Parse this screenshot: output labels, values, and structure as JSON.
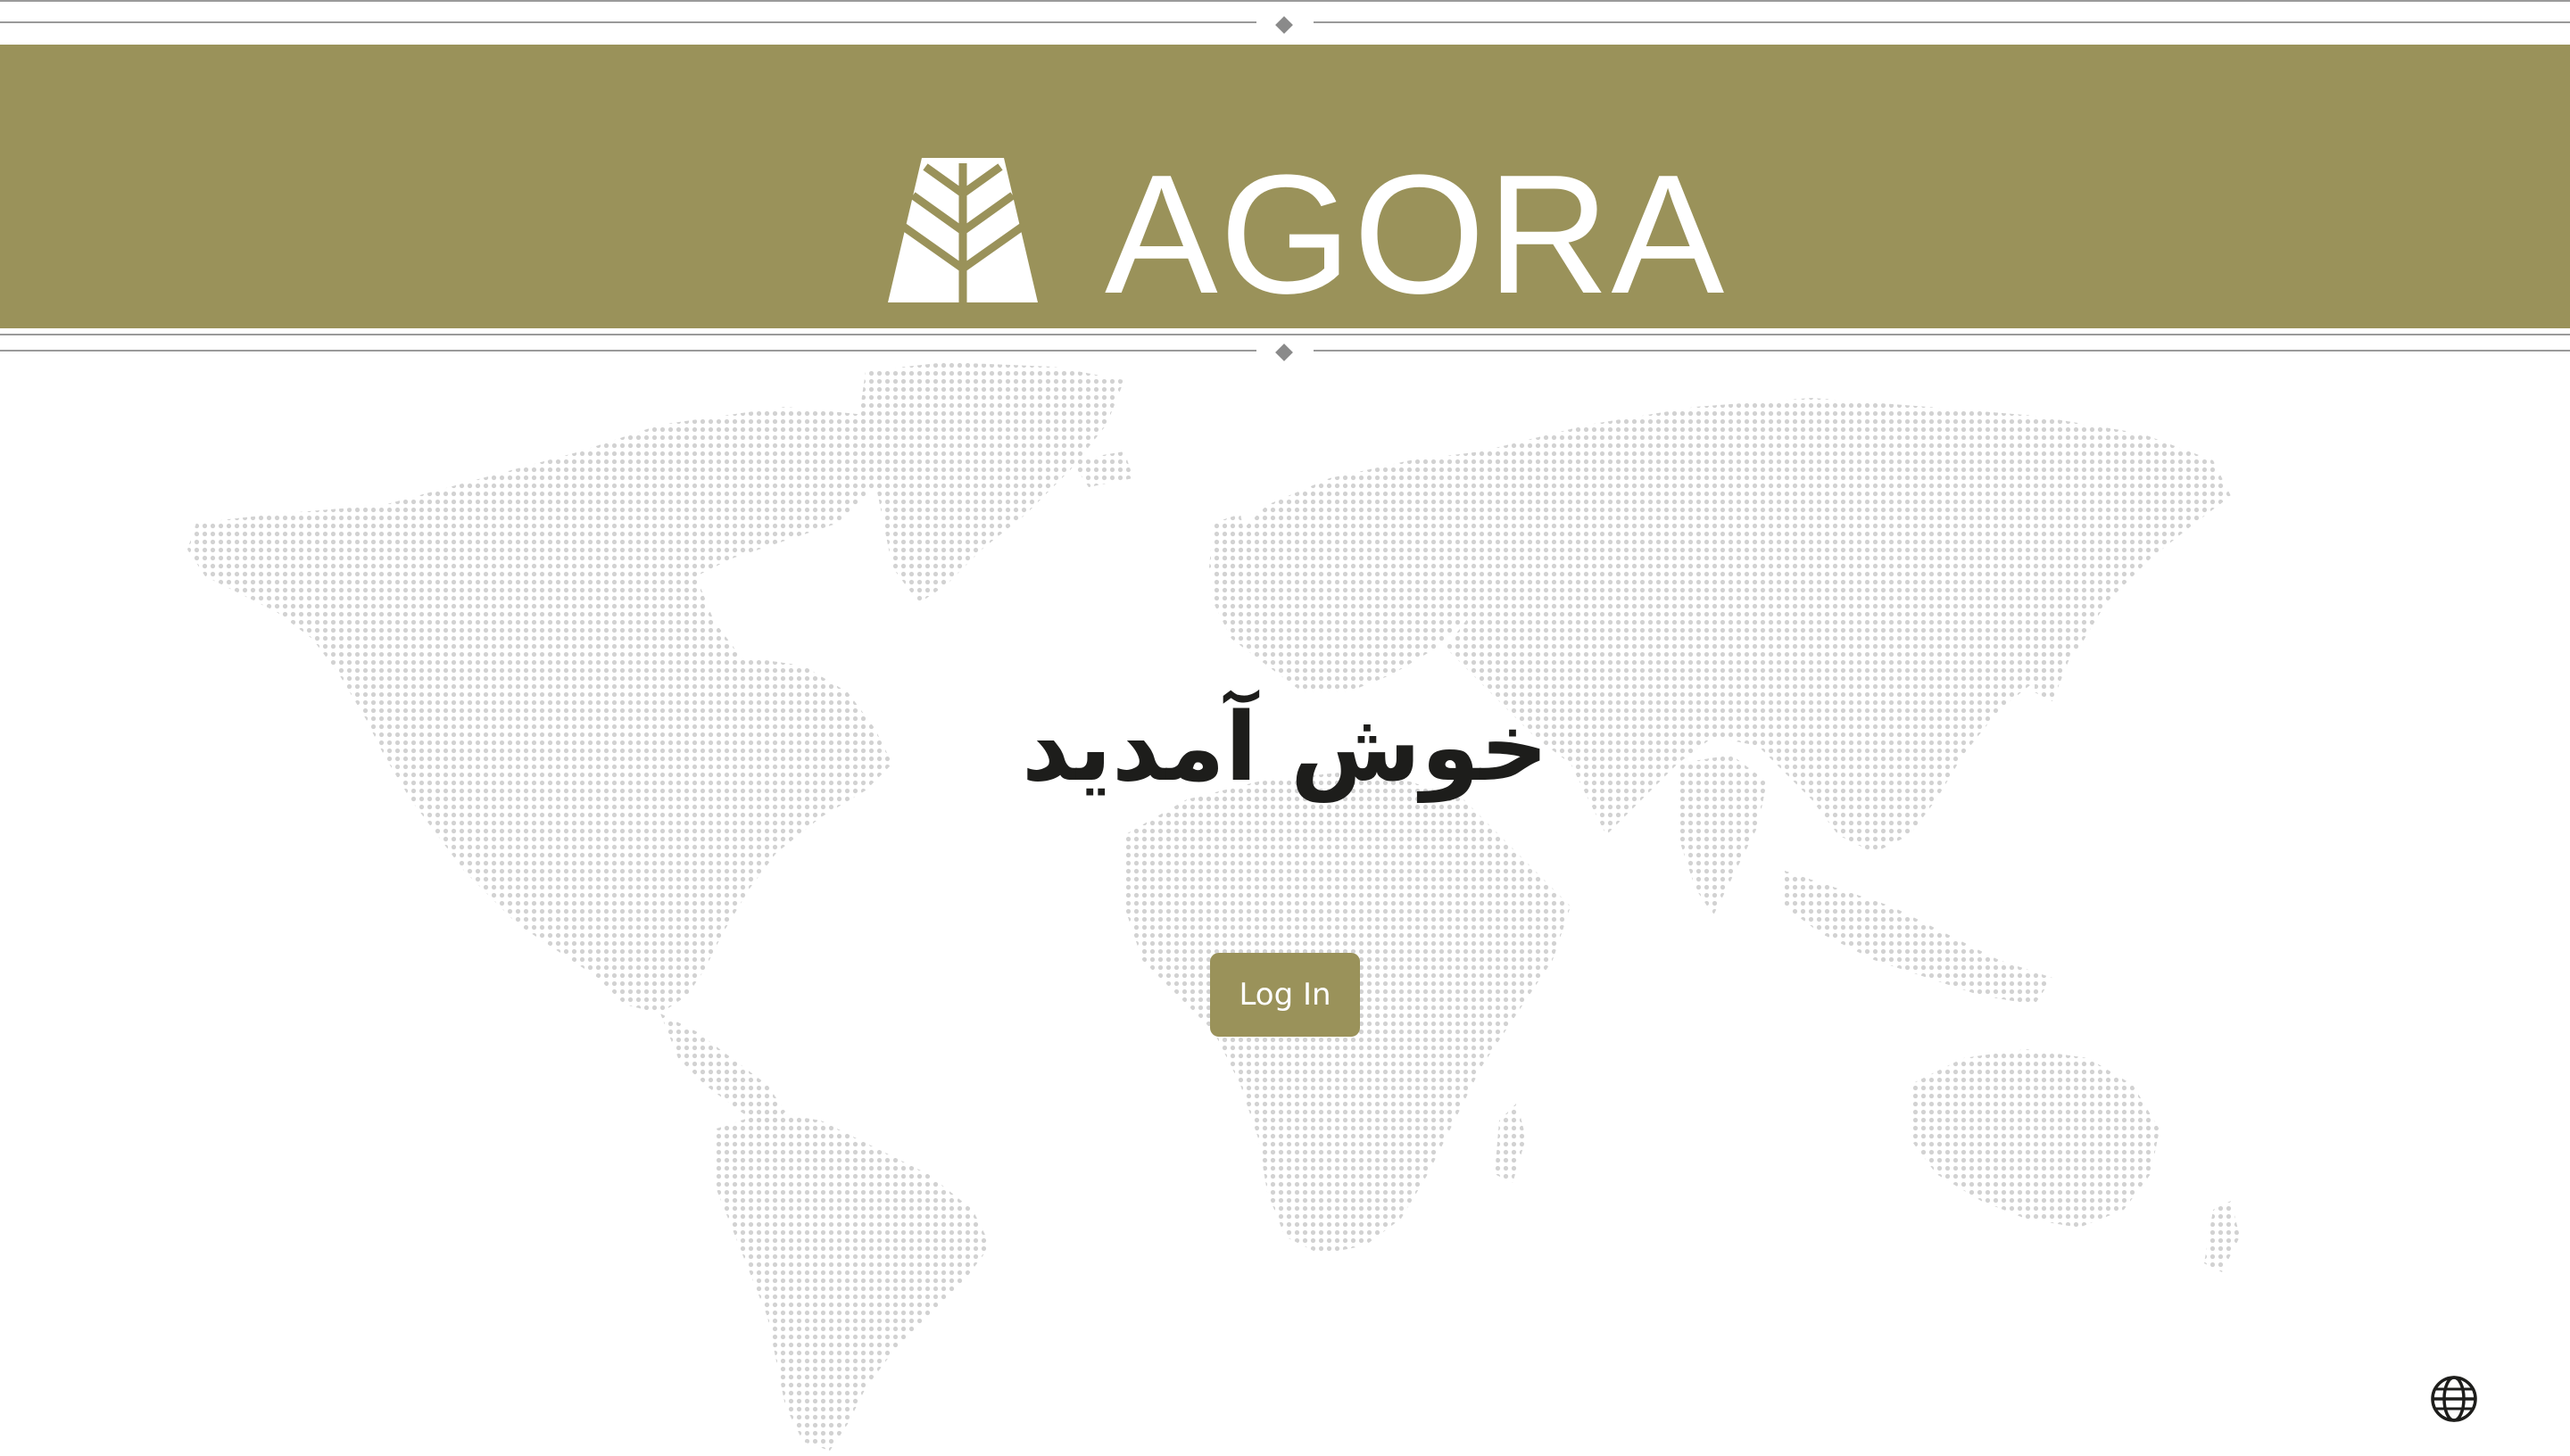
{
  "brand": {
    "name": "AGORA",
    "color": "#9a925a"
  },
  "hero": {
    "welcome_text": "خوش آمدید",
    "login_label": "Log In"
  },
  "icons": {
    "logo": "tree-triangle-logo-icon",
    "background": "dotted-world-map",
    "language": "globe-icon"
  }
}
